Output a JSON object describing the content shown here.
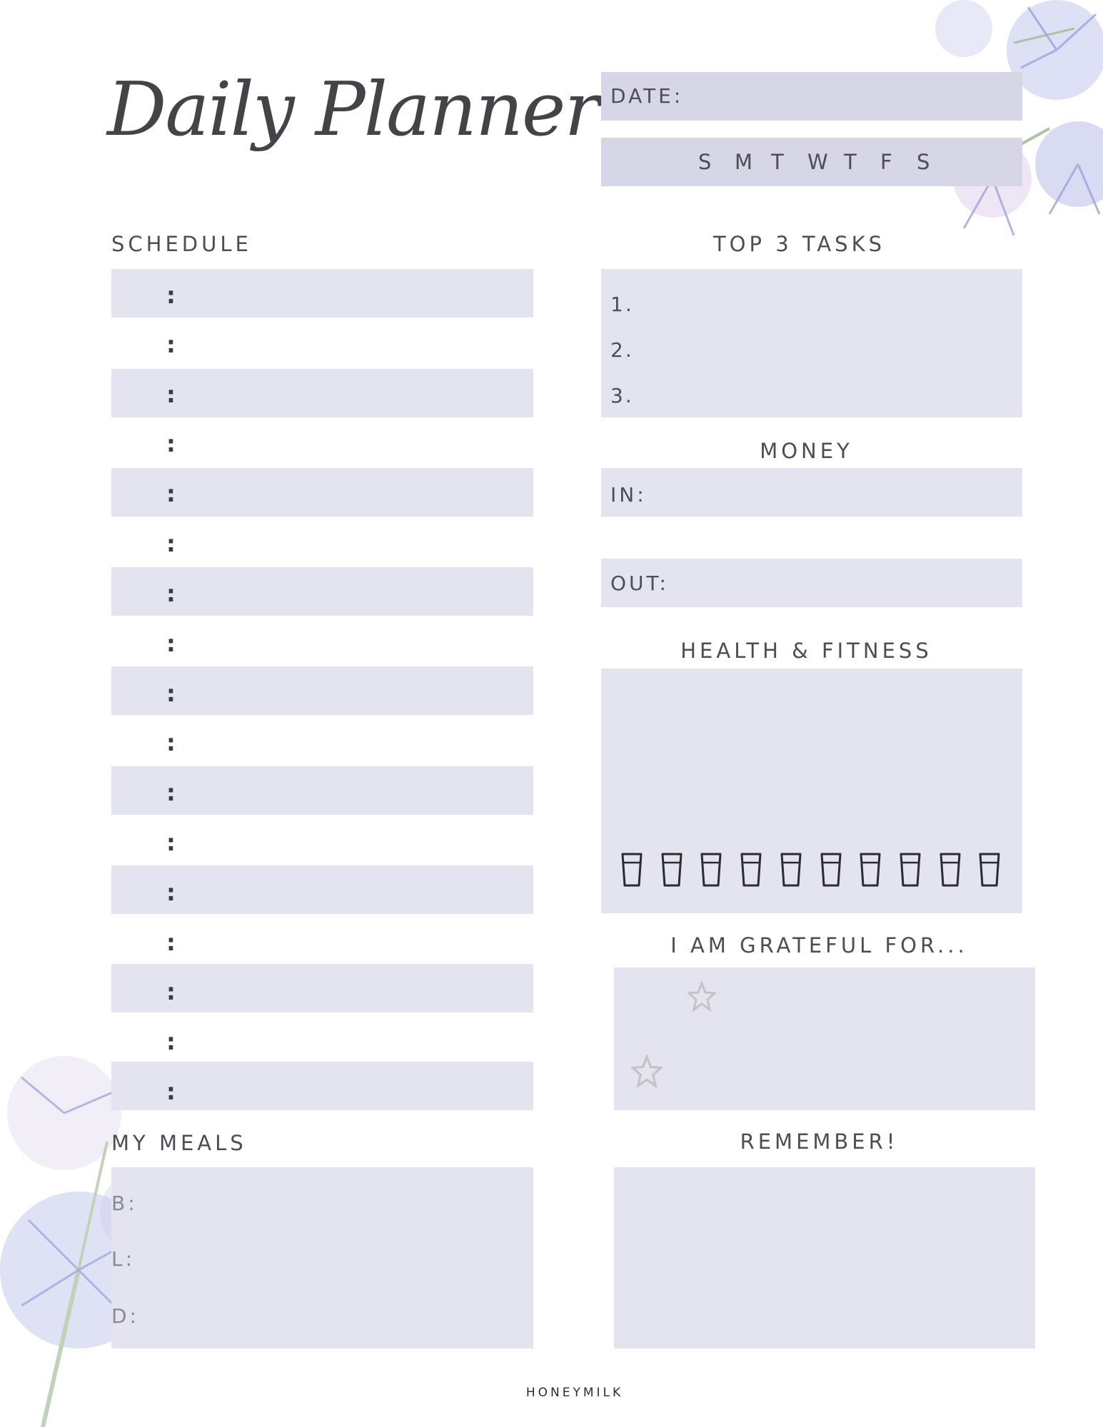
{
  "title": "Daily Planner",
  "header": {
    "date_label": "DATE:",
    "weekdays": [
      "S",
      "M",
      "T",
      "W",
      "T",
      "F",
      "S"
    ]
  },
  "schedule": {
    "heading": "SCHEDULE",
    "separator": ":"
  },
  "tasks": {
    "heading": "TOP 3 TASKS",
    "items": [
      "1.",
      "2.",
      "3."
    ]
  },
  "money": {
    "heading": "MONEY",
    "in_label": "IN:",
    "out_label": "OUT:"
  },
  "health": {
    "heading": "HEALTH & FITNESS",
    "water_glasses": 10
  },
  "grateful": {
    "heading": "I AM GRATEFUL FOR..."
  },
  "meals": {
    "heading": "MY MEALS",
    "breakfast": "B:",
    "lunch": "L:",
    "dinner": "D:"
  },
  "remember": {
    "heading": "REMEMBER!"
  },
  "footer": "HONEYMILK",
  "colors": {
    "band": "#e4e4f0",
    "band_dark": "#d6d6e7",
    "flower": "#8a8fd6"
  }
}
